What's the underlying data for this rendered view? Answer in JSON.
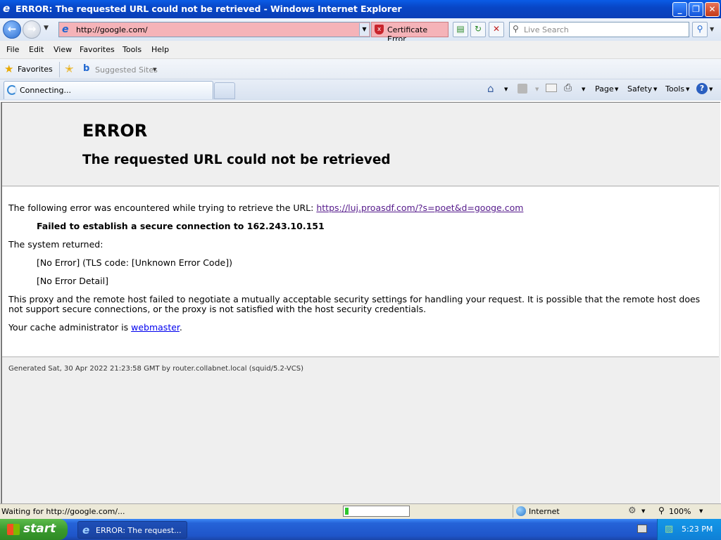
{
  "window": {
    "title": "ERROR: The requested URL could not be retrieved - Windows Internet Explorer",
    "min_label": "_",
    "max_label": "❐",
    "close_label": "✕"
  },
  "address_bar": {
    "url": "http://google.com/",
    "certificate_error_label": "Certificate Error",
    "search_placeholder": "Live Search"
  },
  "menu": [
    "File",
    "Edit",
    "View",
    "Favorites",
    "Tools",
    "Help"
  ],
  "favorites_bar": {
    "favorites_label": "Favorites",
    "suggested_sites_label": "Suggested Sites"
  },
  "tab": {
    "label": "Connecting..."
  },
  "command_bar": {
    "page_label": "Page",
    "safety_label": "Safety",
    "tools_label": "Tools"
  },
  "page": {
    "heading": "ERROR",
    "subheading": "The requested URL could not be retrieved",
    "intro": "The following error was encountered while trying to retrieve the URL: ",
    "error_url": "https://luj.proasdf.com/?s=poet&d=googe.com",
    "failure": "Failed to establish a secure connection to 162.243.10.151",
    "system_returned": "The system returned:",
    "tls_code": "[No Error] (TLS code: [Unknown Error Code])",
    "error_detail": "[No Error Detail]",
    "explanation_line1": "This proxy and the remote host failed to negotiate a mutually acceptable security settings for handling your request. It is possible that the remote host does",
    "explanation_line2": "not support secure connections, or the proxy is not satisfied with the host security credentials.",
    "admin_prefix": "Your cache administrator is ",
    "admin_link": "webmaster",
    "admin_suffix": ".",
    "footer": "Generated Sat, 30 Apr 2022 21:23:58 GMT by router.collabnet.local (squid/5.2-VCS)"
  },
  "status_bar": {
    "text": "Waiting for http://google.com/...",
    "zone": "Internet",
    "zoom": "100%",
    "progress": 0.06
  },
  "taskbar": {
    "start_label": "start",
    "task_label": "ERROR: The request...",
    "clock": "5:23 PM"
  },
  "colors": {
    "address_error_bg": "#f5b3b8",
    "visited_link": "#551a8b",
    "link": "#0000ee",
    "taskbar_blue": "#2563d8",
    "start_green": "#3a9a2e"
  }
}
